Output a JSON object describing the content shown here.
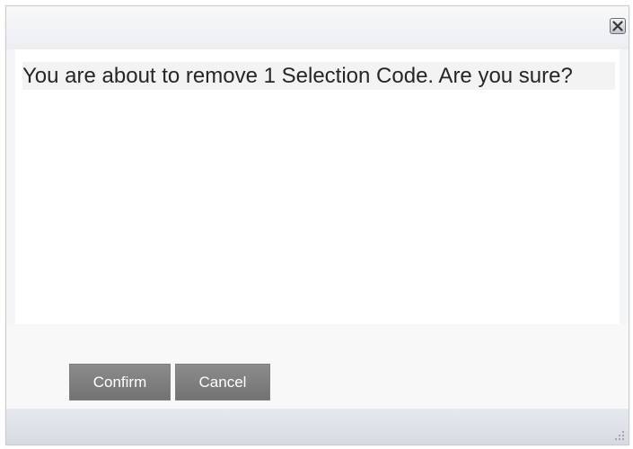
{
  "dialog": {
    "message": "You are about to remove 1 Selection Code. Are you sure?",
    "close_icon": "close-icon",
    "resize_icon": "resize-grip-icon",
    "buttons": {
      "confirm_label": "Confirm",
      "cancel_label": "Cancel"
    },
    "colors": {
      "button_bg": "#7f7f7f",
      "button_text": "#ffffff",
      "titlebar_bg": "#eef0f3",
      "footer_bg": "#dde1e6"
    }
  }
}
